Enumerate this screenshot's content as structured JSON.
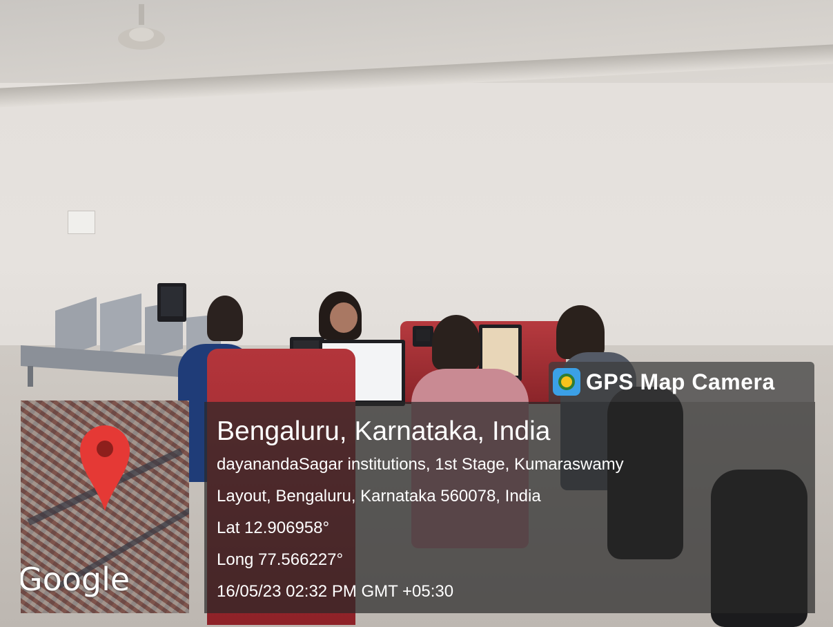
{
  "badge": {
    "title": "GPS Map Camera",
    "logo_icon": "gps-map-camera-logo-icon"
  },
  "info": {
    "city": "Bengaluru, Karnataka, India",
    "address_line_1": "dayanandaSagar institutions, 1st Stage, Kumaraswamy",
    "address_line_2": "Layout, Bengaluru, Karnataka 560078, India",
    "latitude": "Lat 12.906958°",
    "longitude": "Long 77.566227°",
    "datetime": "16/05/23 02:32 PM GMT +05:30"
  },
  "map": {
    "provider_label": "Google",
    "pin_icon": "map-pin-icon",
    "pin_color": "#e53935"
  },
  "colors": {
    "overlay": "#282828",
    "desk_red": "#a8323a"
  }
}
